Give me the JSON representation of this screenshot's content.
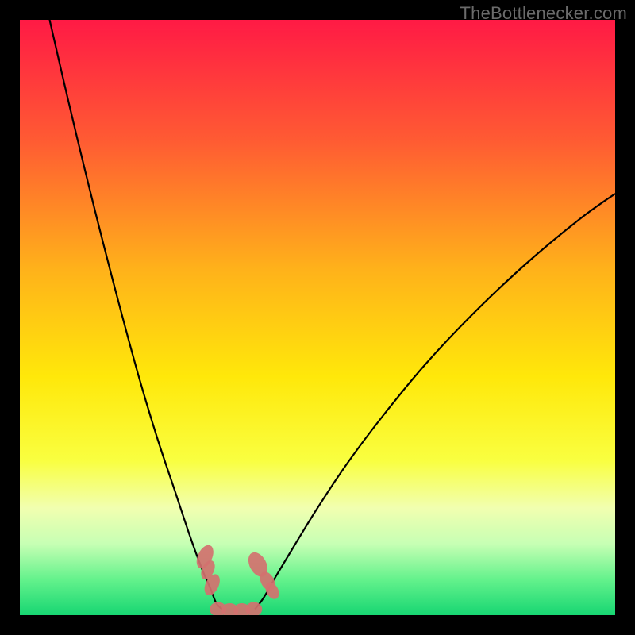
{
  "watermark": "TheBottlenecker.com",
  "chart_data": {
    "type": "line",
    "title": "",
    "xlabel": "",
    "ylabel": "",
    "xlim": [
      0,
      1
    ],
    "ylim": [
      0,
      1
    ],
    "description": "Bottleneck curve on a red-to-green vertical gradient background",
    "gradient_stops": [
      {
        "offset": 0.0,
        "color": "#ff1a45"
      },
      {
        "offset": 0.2,
        "color": "#ff5a33"
      },
      {
        "offset": 0.42,
        "color": "#ffb21a"
      },
      {
        "offset": 0.6,
        "color": "#ffe80a"
      },
      {
        "offset": 0.74,
        "color": "#f9ff40"
      },
      {
        "offset": 0.82,
        "color": "#f1ffb0"
      },
      {
        "offset": 0.88,
        "color": "#c7ffb4"
      },
      {
        "offset": 0.94,
        "color": "#64f28c"
      },
      {
        "offset": 1.0,
        "color": "#17d672"
      }
    ],
    "series": [
      {
        "name": "left-branch",
        "x": [
          0.05,
          0.08,
          0.11,
          0.14,
          0.17,
          0.2,
          0.23,
          0.26,
          0.285,
          0.305,
          0.32,
          0.33,
          0.34
        ],
        "y": [
          1.0,
          0.87,
          0.745,
          0.625,
          0.51,
          0.4,
          0.3,
          0.21,
          0.135,
          0.08,
          0.045,
          0.02,
          0.01
        ]
      },
      {
        "name": "right-branch",
        "x": [
          0.395,
          0.41,
          0.43,
          0.46,
          0.5,
          0.55,
          0.61,
          0.68,
          0.76,
          0.85,
          0.94,
          1.0
        ],
        "y": [
          0.01,
          0.03,
          0.065,
          0.115,
          0.18,
          0.255,
          0.335,
          0.42,
          0.505,
          0.59,
          0.665,
          0.708
        ]
      }
    ],
    "markers": [
      {
        "x": 0.311,
        "y": 0.098,
        "rx": 0.012,
        "ry": 0.021,
        "rot": 25
      },
      {
        "x": 0.316,
        "y": 0.076,
        "rx": 0.01,
        "ry": 0.017,
        "rot": 25
      },
      {
        "x": 0.323,
        "y": 0.051,
        "rx": 0.011,
        "ry": 0.019,
        "rot": 25
      },
      {
        "x": 0.4,
        "y": 0.085,
        "rx": 0.014,
        "ry": 0.022,
        "rot": -28
      },
      {
        "x": 0.416,
        "y": 0.057,
        "rx": 0.011,
        "ry": 0.017,
        "rot": -28
      },
      {
        "x": 0.424,
        "y": 0.041,
        "rx": 0.01,
        "ry": 0.015,
        "rot": -28
      },
      {
        "x": 0.333,
        "y": 0.01,
        "rx": 0.014,
        "ry": 0.012,
        "rot": 0
      },
      {
        "x": 0.353,
        "y": 0.008,
        "rx": 0.014,
        "ry": 0.012,
        "rot": 0
      },
      {
        "x": 0.373,
        "y": 0.008,
        "rx": 0.014,
        "ry": 0.012,
        "rot": 0
      },
      {
        "x": 0.393,
        "y": 0.01,
        "rx": 0.014,
        "ry": 0.012,
        "rot": 0
      }
    ],
    "marker_color": "#d2716f",
    "curve_color": "#000000"
  }
}
